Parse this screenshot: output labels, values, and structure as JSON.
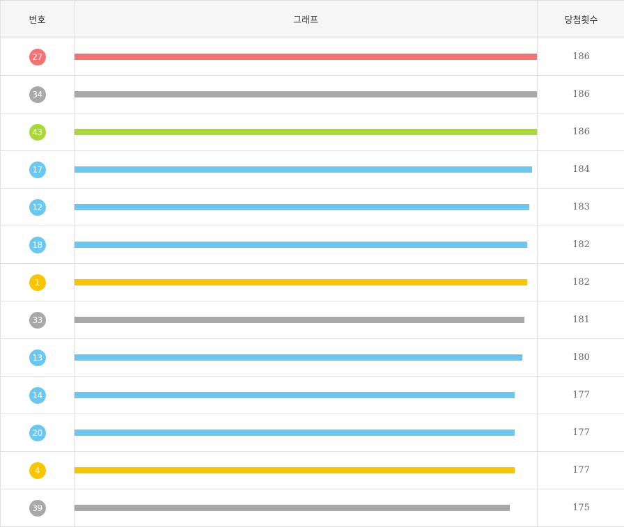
{
  "header": {
    "number_label": "번호",
    "graph_label": "그래프",
    "count_label": "당첨횟수"
  },
  "colors": {
    "red": "#f87171",
    "gray": "#a8a8a8",
    "green": "#a9d83b",
    "blue": "#6ac7ef",
    "yellow": "#f7c600"
  },
  "chart_data": {
    "type": "bar",
    "orientation": "horizontal",
    "title": "",
    "xlabel": "그래프",
    "ylabel": "번호",
    "xlim": [
      0,
      186
    ],
    "categories": [
      "27",
      "34",
      "43",
      "17",
      "12",
      "18",
      "1",
      "33",
      "13",
      "14",
      "20",
      "4",
      "39"
    ],
    "values": [
      186,
      186,
      186,
      184,
      183,
      182,
      182,
      181,
      180,
      177,
      177,
      177,
      175
    ],
    "bar_colors": [
      "red",
      "gray",
      "green",
      "blue",
      "blue",
      "blue",
      "yellow",
      "gray",
      "blue",
      "blue",
      "blue",
      "yellow",
      "gray"
    ]
  },
  "rows": [
    {
      "number": "27",
      "count": "186",
      "color": "red"
    },
    {
      "number": "34",
      "count": "186",
      "color": "gray"
    },
    {
      "number": "43",
      "count": "186",
      "color": "green"
    },
    {
      "number": "17",
      "count": "184",
      "color": "blue"
    },
    {
      "number": "12",
      "count": "183",
      "color": "blue"
    },
    {
      "number": "18",
      "count": "182",
      "color": "blue"
    },
    {
      "number": "1",
      "count": "182",
      "color": "yellow"
    },
    {
      "number": "33",
      "count": "181",
      "color": "gray"
    },
    {
      "number": "13",
      "count": "180",
      "color": "blue"
    },
    {
      "number": "14",
      "count": "177",
      "color": "blue"
    },
    {
      "number": "20",
      "count": "177",
      "color": "blue"
    },
    {
      "number": "4",
      "count": "177",
      "color": "yellow"
    },
    {
      "number": "39",
      "count": "175",
      "color": "gray"
    }
  ]
}
